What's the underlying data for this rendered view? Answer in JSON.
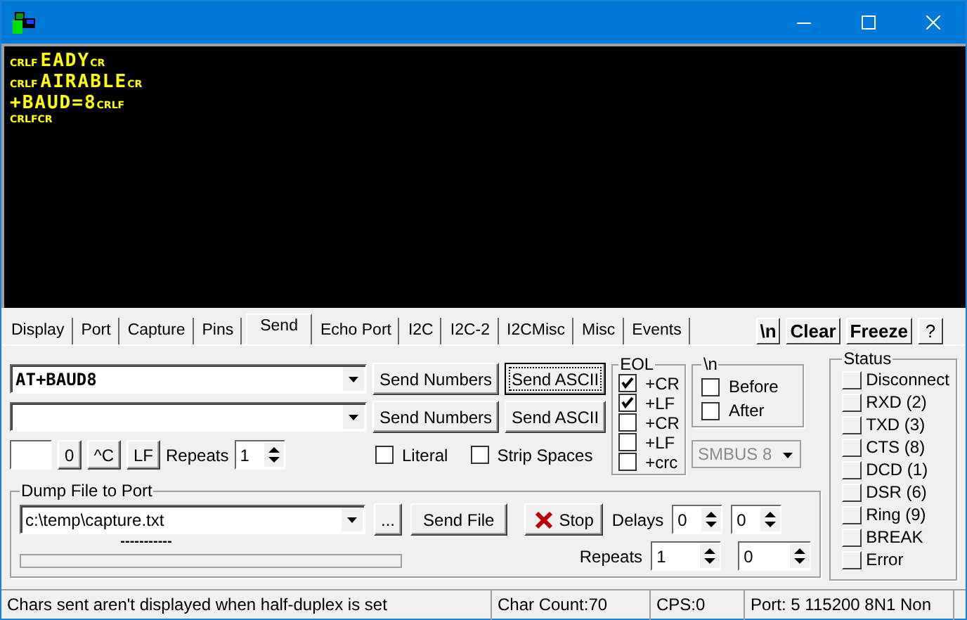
{
  "terminal": {
    "lines": [
      {
        "segments": [
          {
            "kind": "ctrl",
            "text": "CRLF"
          },
          {
            "kind": "text",
            "text": "EADY"
          },
          {
            "kind": "ctrl",
            "text": "CR"
          }
        ]
      },
      {
        "segments": [
          {
            "kind": "ctrl",
            "text": "CRLF"
          },
          {
            "kind": "text",
            "text": "AIRABLE"
          },
          {
            "kind": "ctrl",
            "text": "CR"
          }
        ]
      },
      {
        "segments": [
          {
            "kind": "text",
            "text": "+BAUD=8"
          },
          {
            "kind": "ctrl",
            "text": "CRLF"
          }
        ]
      },
      {
        "segments": [
          {
            "kind": "ctrl",
            "text": "CRLFCR"
          }
        ]
      }
    ]
  },
  "tabs": [
    {
      "label": "Display",
      "selected": false
    },
    {
      "label": "Port",
      "selected": false
    },
    {
      "label": "Capture",
      "selected": false
    },
    {
      "label": "Pins",
      "selected": false
    },
    {
      "label": "Send",
      "selected": true
    },
    {
      "label": "Echo Port",
      "selected": false
    },
    {
      "label": "I2C",
      "selected": false
    },
    {
      "label": "I2C-2",
      "selected": false
    },
    {
      "label": "I2CMisc",
      "selected": false
    },
    {
      "label": "Misc",
      "selected": false
    },
    {
      "label": "Events",
      "selected": false
    }
  ],
  "toolbar_buttons": [
    "\\n",
    "Clear",
    "Freeze",
    "?"
  ],
  "send_rows": [
    {
      "value": "AT+BAUD8",
      "buttons": [
        {
          "label": "Send Numbers",
          "focused": false
        },
        {
          "label": "Send ASCII",
          "focused": true
        }
      ]
    },
    {
      "value": "",
      "buttons": [
        {
          "label": "Send Numbers",
          "focused": false
        },
        {
          "label": "Send ASCII",
          "focused": false
        }
      ]
    }
  ],
  "control_row": {
    "keys": [
      "0",
      "^C",
      "LF"
    ],
    "repeats_label": "Repeats",
    "repeats": "1"
  },
  "options": [
    {
      "label": "Literal",
      "checked": false
    },
    {
      "label": "Strip Spaces",
      "checked": false
    }
  ],
  "eol": {
    "title": "EOL",
    "options": [
      {
        "label": "+CR",
        "checked": true
      },
      {
        "label": "+LF",
        "checked": true
      },
      {
        "label": "+CR",
        "checked": false
      },
      {
        "label": "+LF",
        "checked": false
      },
      {
        "label": "+crc",
        "checked": false
      }
    ]
  },
  "newline": {
    "title": "\\n",
    "options": [
      {
        "label": "Before",
        "checked": false
      },
      {
        "label": "After",
        "checked": false
      }
    ]
  },
  "smbus": {
    "value": "SMBUS 8",
    "disabled": true
  },
  "dump": {
    "title": "Dump File to Port",
    "file": "c:\\temp\\capture.txt",
    "browse": "...",
    "send_file": "Send File",
    "stop": "Stop",
    "delays_label": "Delays",
    "delays": [
      "0",
      "0"
    ],
    "progress_text": "-----------",
    "level": 0,
    "repeats_label": "Repeats",
    "repeats": [
      "1",
      "0"
    ]
  },
  "status": {
    "title": "Status",
    "items": [
      {
        "label": "Disconnect",
        "on": false
      },
      {
        "label": "RXD (2)",
        "on": false
      },
      {
        "label": "TXD (3)",
        "on": false
      },
      {
        "label": "CTS (8)",
        "on": false
      },
      {
        "label": "DCD (1)",
        "on": false
      },
      {
        "label": "DSR (6)",
        "on": false
      },
      {
        "label": "Ring (9)",
        "on": false
      },
      {
        "label": "BREAK",
        "on": false
      },
      {
        "label": "Error",
        "on": false
      }
    ]
  },
  "status_bar": [
    "Chars sent aren't displayed when half-duplex is set",
    "Char Count:70",
    "CPS:0",
    "Port: 5 115200 8N1 Non"
  ]
}
